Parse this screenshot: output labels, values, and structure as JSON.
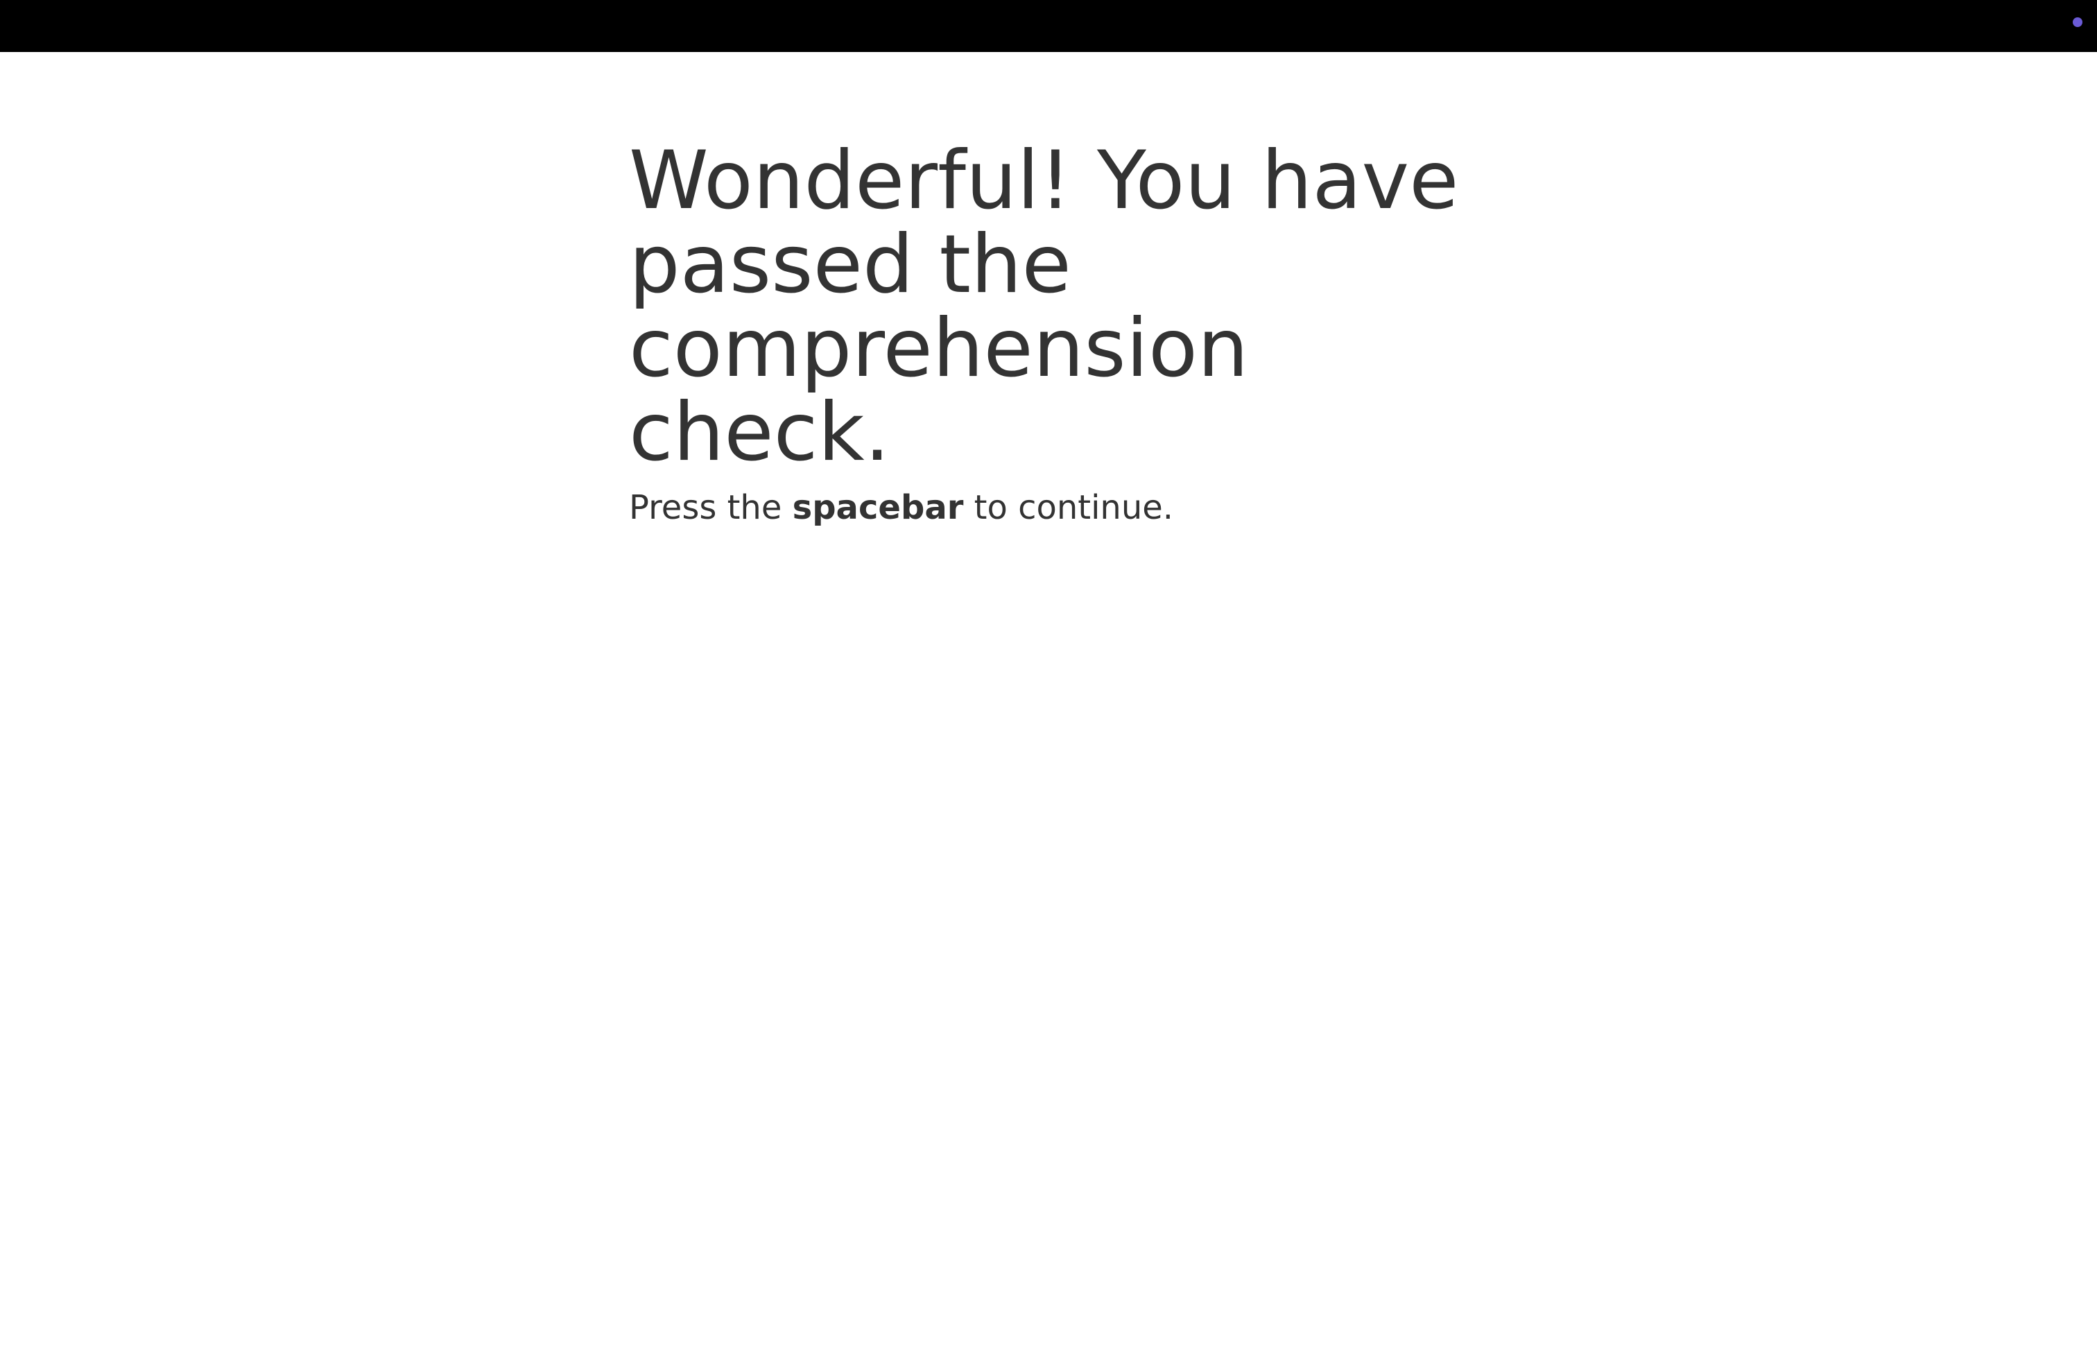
{
  "status_indicator": {
    "color": "#6b5bd6",
    "icon": "status-dot-icon"
  },
  "message": {
    "heading": "Wonderful! You have passed the comprehension check.",
    "instruction_before": "Press the ",
    "instruction_key": "spacebar",
    "instruction_after": " to continue."
  }
}
